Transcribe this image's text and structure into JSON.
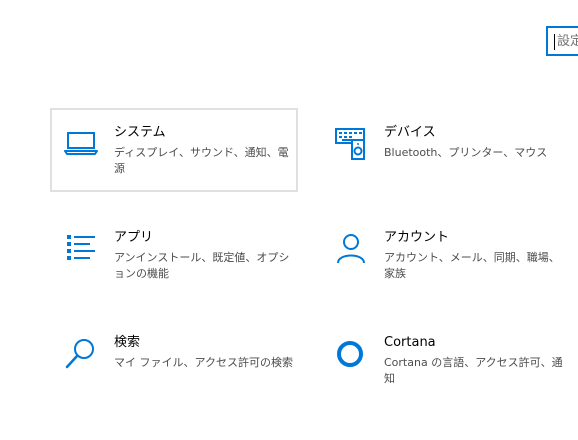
{
  "search": {
    "placeholder": "設定の検索"
  },
  "tiles": [
    {
      "title": "システム",
      "desc": "ディスプレイ、サウンド、通知、電源",
      "icon": "laptop-icon"
    },
    {
      "title": "デバイス",
      "desc": "Bluetooth、プリンター、マウス",
      "icon": "devices-icon"
    },
    {
      "title": "アプリ",
      "desc": "アンインストール、既定値、オプションの機能",
      "icon": "apps-list-icon"
    },
    {
      "title": "アカウント",
      "desc": "アカウント、メール、同期、職場、家族",
      "icon": "person-icon"
    },
    {
      "title": "検索",
      "desc": "マイ ファイル、アクセス許可の検索",
      "icon": "search-icon"
    },
    {
      "title": "Cortana",
      "desc": "Cortana の言語、アクセス許可、通知",
      "icon": "cortana-icon"
    }
  ],
  "colors": {
    "accent": "#0078d7",
    "focus_border": "#e0e0e0"
  }
}
